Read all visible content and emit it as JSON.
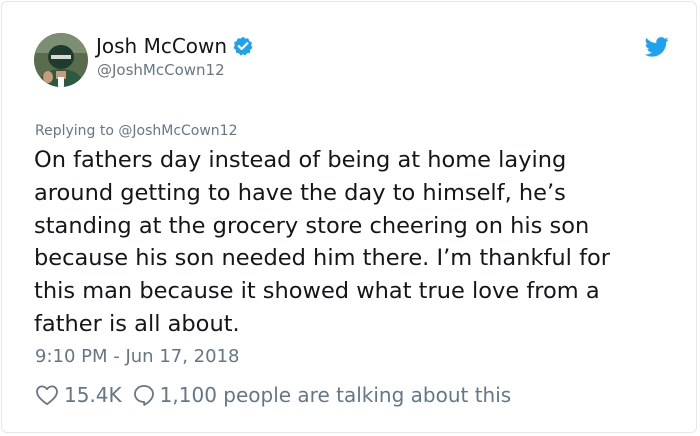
{
  "author": {
    "name": "Josh McCown",
    "handle": "@JoshMcCown12",
    "verified": true
  },
  "tweet": {
    "reply_to": "Replying to @JoshMcCown12",
    "text": "On fathers day instead of being at home laying\naround getting to have the day to himself, he’s\nstanding at the grocery store cheering on his son\nbecause his son needed him there.  I’m thankful for\nthis man because it showed what true love from a\nfather is all about.",
    "timestamp": "9:10 PM - Jun 17, 2018",
    "likes": "15.4K",
    "talking": "1,100 people are talking about this"
  },
  "icons": {
    "verified": "verified-badge-icon",
    "brand": "twitter-bird-icon",
    "like": "heart-icon",
    "reply": "speech-bubble-icon"
  },
  "colors": {
    "brand_blue": "#1da1f2",
    "text": "#14171a",
    "secondary": "#657786",
    "border": "#e1e8ed"
  }
}
